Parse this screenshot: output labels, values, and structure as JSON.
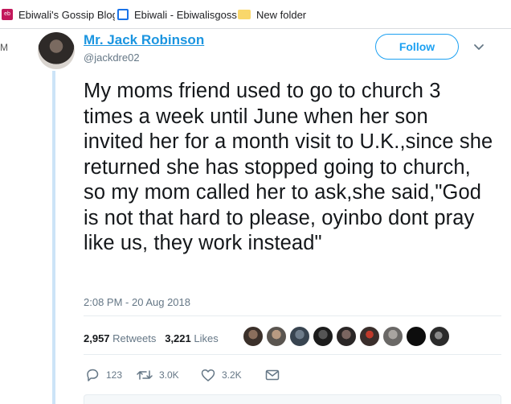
{
  "bookmarks": [
    {
      "label": "Ebiwali's Gossip Blog",
      "icon": "ebiwali-favicon-icon"
    },
    {
      "label": "Ebiwali - Ebiwalisgoss",
      "icon": "bookmark-page-icon"
    },
    {
      "label": "New folder",
      "icon": "folder-icon"
    }
  ],
  "left_margin_text": "M",
  "tweet": {
    "author_name": "Mr. Jack Robinson",
    "handle": "@jackdre02",
    "follow_label": "Follow",
    "text": "My moms friend used to go to church 3 times a week until June when her son invited her for a month visit to U.K.,since she returned she has stopped going to church, so my mom called her to ask,she said,\"God is not that hard to please, oyinbo dont pray like us, they work instead\"",
    "timestamp": "2:08 PM - 20 Aug 2018",
    "retweets_count": "2,957",
    "retweets_label": "Retweets",
    "likes_count": "3,221",
    "likes_label": "Likes",
    "reply_count": "123",
    "retweet_action_count": "3.0K",
    "like_action_count": "3.2K"
  },
  "colors": {
    "accent": "#1da1f2",
    "link": "#1b95e0",
    "muted": "#657786",
    "thread": "#cce4f7"
  }
}
